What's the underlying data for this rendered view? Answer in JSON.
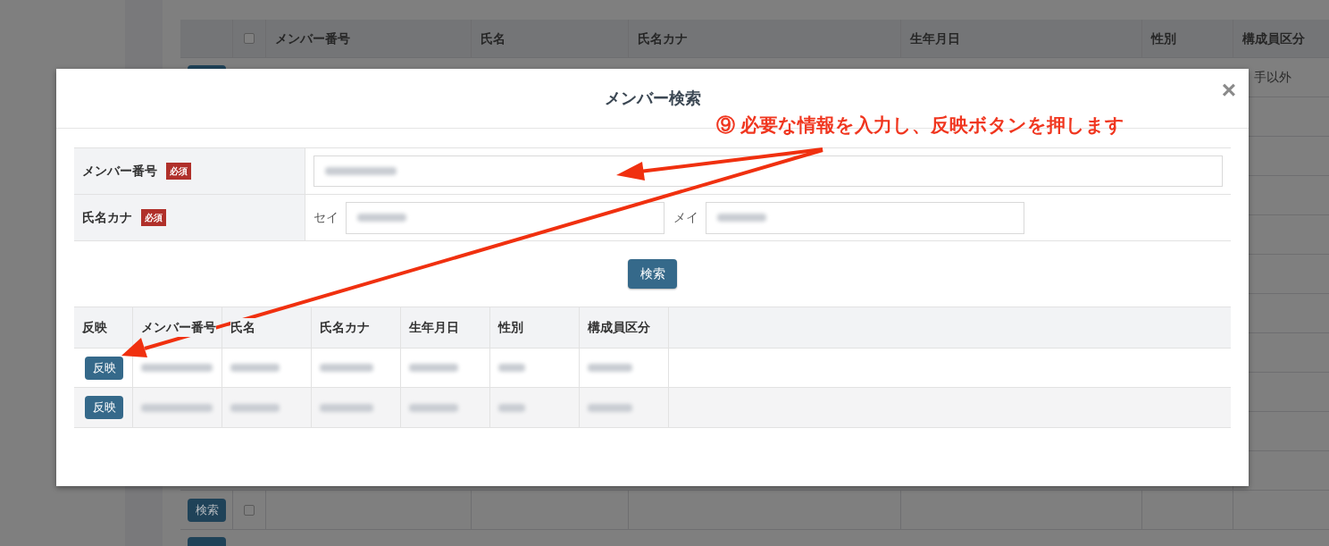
{
  "background_table": {
    "header_checkbox": {
      "checked": false
    },
    "columns": [
      "メンバー番号",
      "氏名",
      "氏名カナ",
      "生年月日",
      "性別",
      "構成員区分"
    ],
    "first_row": {
      "member_type": "手以外"
    },
    "bottom_row": {
      "button": "検索",
      "checked": false
    }
  },
  "modal": {
    "title": "メンバー検索",
    "close": "×",
    "form": [
      {
        "kind": "single",
        "label": "メンバー番号",
        "badge": "必須"
      },
      {
        "kind": "split",
        "label": "氏名カナ",
        "badge": "必須",
        "parts": [
          "セイ",
          "メイ"
        ]
      }
    ],
    "search_button": "検索",
    "results": {
      "columns": [
        "反映",
        "メンバー番号",
        "氏名",
        "氏名カナ",
        "生年月日",
        "性別",
        "構成員区分"
      ],
      "rows": [
        {
          "button": "反映"
        },
        {
          "button": "反映"
        }
      ]
    }
  },
  "annotation": {
    "text": "⑨ 必要な情報を入力し、反映ボタンを押します"
  }
}
